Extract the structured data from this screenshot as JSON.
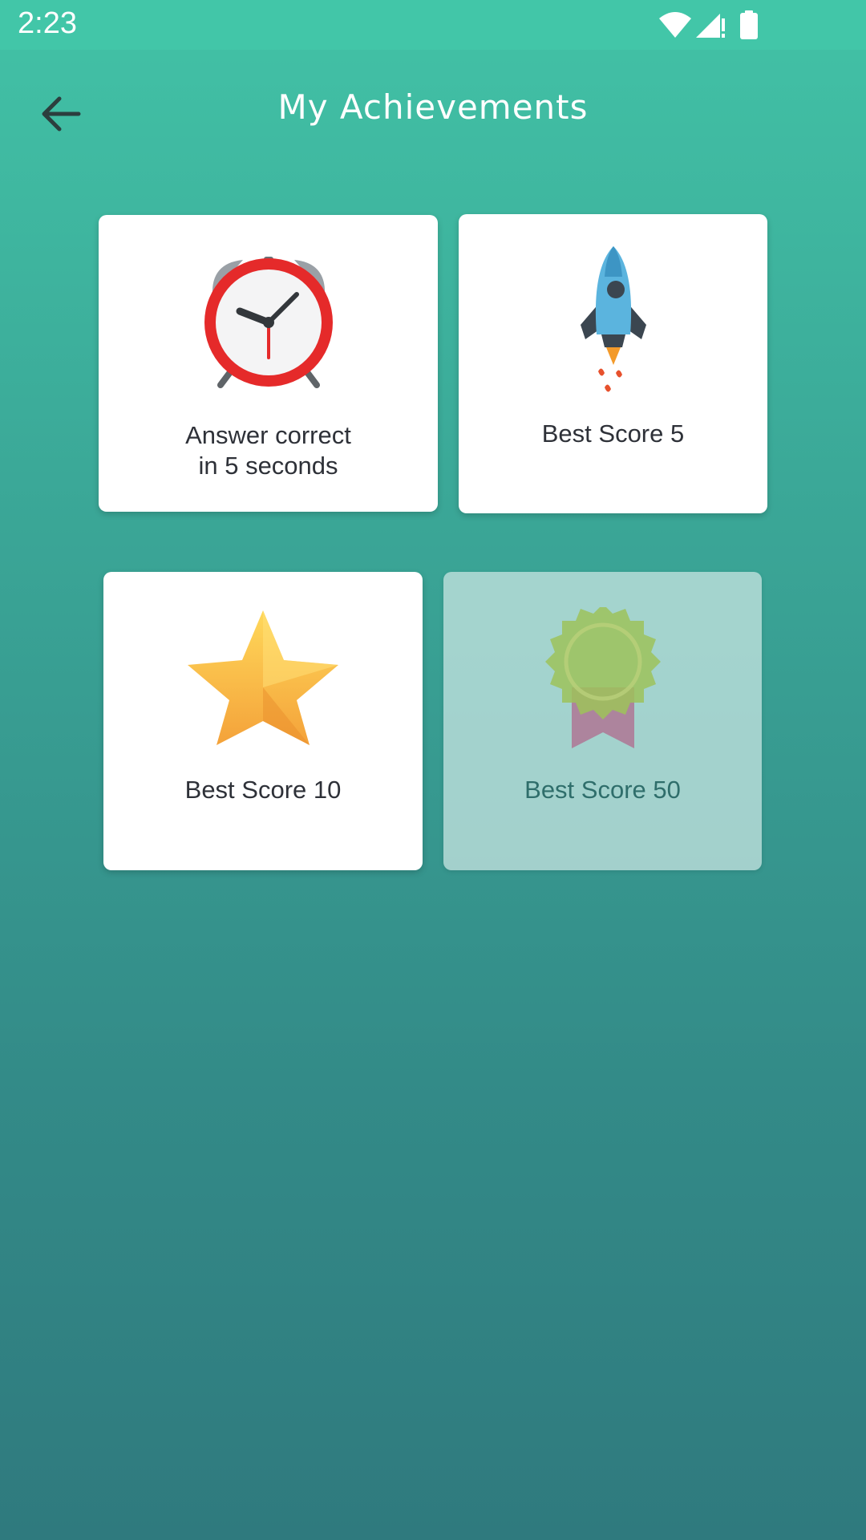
{
  "status_bar": {
    "time": "2:23",
    "icons": [
      "wifi-icon",
      "cellular-signal-icon",
      "battery-icon"
    ]
  },
  "app_bar": {
    "title": "My Achievements",
    "back_icon": "arrow-left-icon"
  },
  "achievements": [
    {
      "icon": "alarm-clock-icon",
      "label_lines": [
        "Answer correct",
        "in 5 seconds"
      ],
      "unlocked": true
    },
    {
      "icon": "rocket-icon",
      "label_lines": [
        "Best Score 5"
      ],
      "unlocked": true
    },
    {
      "icon": "star-icon",
      "label_lines": [
        "Best Score 10"
      ],
      "unlocked": true
    },
    {
      "icon": "award-rosette-icon",
      "label_lines": [
        "Best Score 50"
      ],
      "unlocked": false
    }
  ],
  "colors": {
    "status_bar": "#42c6a8",
    "gradient_top": "#42c2a6",
    "gradient_bottom": "#2f7a7e",
    "card": "#ffffff",
    "locked_card": "#cde8e4",
    "label_text": "#2e3138"
  }
}
